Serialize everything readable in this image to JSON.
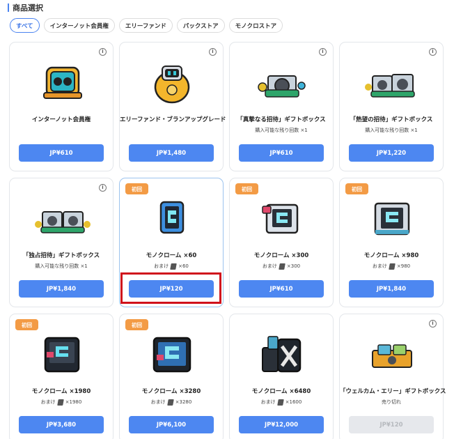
{
  "header": {
    "title": "商品選択"
  },
  "tabs": [
    {
      "label": "すべて"
    },
    {
      "label": "インターノット会員権"
    },
    {
      "label": "エリーファンド"
    },
    {
      "label": "パックストア"
    },
    {
      "label": "モノクロストア"
    }
  ],
  "active_tab": "すべて",
  "products": [
    {
      "name": "インターノット会員権",
      "price": "JP¥610"
    },
    {
      "name": "エリーファンド・ブランアップグレード",
      "price": "JP¥1,480"
    },
    {
      "name": "「真摯なる招待」ギフトボックス",
      "sub": "購入可能な残り回数 ×1",
      "price": "JP¥610"
    },
    {
      "name": "「熱望の招待」ギフトボックス",
      "sub": "購入可能な残り回数 ×1",
      "price": "JP¥1,220"
    },
    {
      "name": "「独占招待」ギフトボックス",
      "sub": "購入可能な残り回数 ×1",
      "price": "JP¥1,840"
    },
    {
      "badge": "初回",
      "name": "モノクローム ×60",
      "sub_prefix": "おまけ",
      "sub_value": "×60",
      "price": "JP¥120"
    },
    {
      "badge": "初回",
      "name": "モノクローム ×300",
      "sub_prefix": "おまけ",
      "sub_value": "×300",
      "price": "JP¥610"
    },
    {
      "badge": "初回",
      "name": "モノクローム ×980",
      "sub_prefix": "おまけ",
      "sub_value": "×980",
      "price": "JP¥1,840"
    },
    {
      "badge": "初回",
      "name": "モノクローム ×1980",
      "sub_prefix": "おまけ",
      "sub_value": "×1980",
      "price": "JP¥3,680"
    },
    {
      "badge": "初回",
      "name": "モノクローム ×3280",
      "sub_prefix": "おまけ",
      "sub_value": "×3280",
      "price": "JP¥6,100"
    },
    {
      "name": "モノクローム ×6480",
      "sub_prefix": "おまけ",
      "sub_value": "×1600",
      "price": "JP¥12,000"
    },
    {
      "name": "「ウェルカム・エリー」ギフトボックス",
      "sub": "売り切れ",
      "price": "JP¥120"
    }
  ],
  "info_icon_glyph": "i",
  "colors": {
    "accent": "#4d87f1",
    "badge": "#f39b45",
    "highlight": "#d0121c",
    "disabled": "#e6e8ec"
  }
}
